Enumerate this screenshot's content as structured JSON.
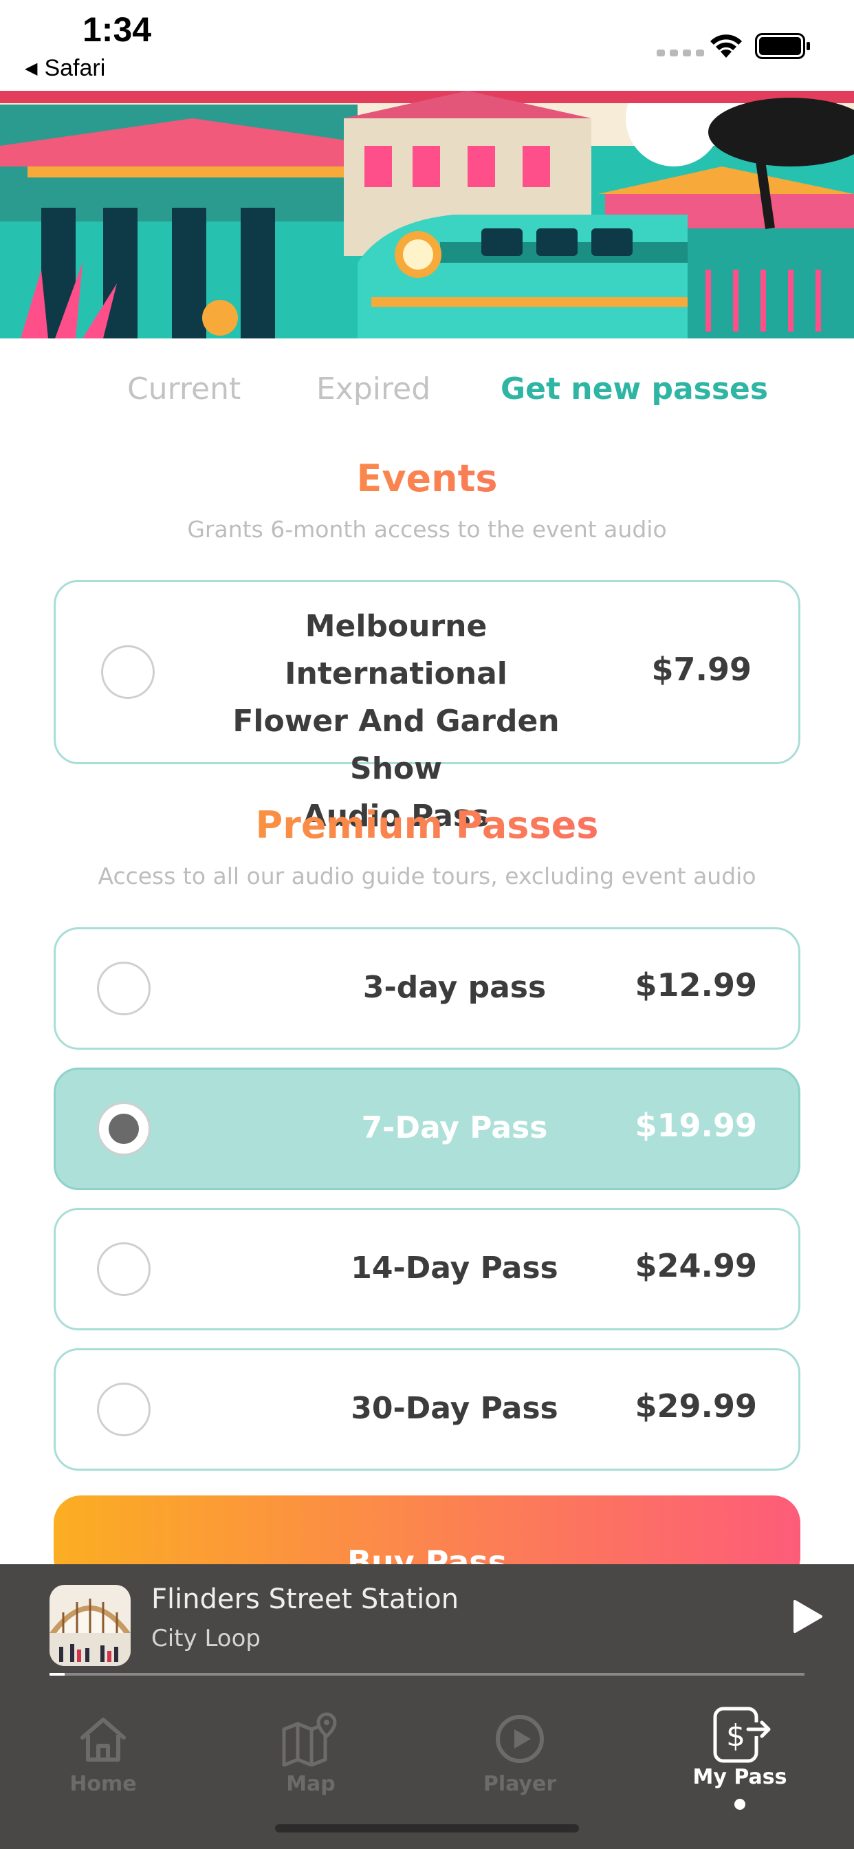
{
  "status_bar": {
    "time": "1:34",
    "back_app": "Safari"
  },
  "tabs": {
    "current": "Current",
    "expired": "Expired",
    "get_new": "Get new passes"
  },
  "events": {
    "title": "Events",
    "subtitle": "Grants 6-month access to the event audio",
    "items": [
      {
        "name_lines": [
          "Melbourne International",
          "Flower And Garden Show",
          "Audio Pass"
        ],
        "price": "$7.99",
        "selected": false
      }
    ]
  },
  "premium": {
    "title": "Premium Passes",
    "subtitle": "Access to all our audio guide tours, excluding event audio",
    "items": [
      {
        "name": "3-day pass",
        "price": "$12.99",
        "selected": false
      },
      {
        "name": "7-Day Pass",
        "price": "$19.99",
        "selected": true
      },
      {
        "name": "14-Day Pass",
        "price": "$24.99",
        "selected": false
      },
      {
        "name": "30-Day Pass",
        "price": "$29.99",
        "selected": false
      }
    ]
  },
  "buy_button": {
    "label": "Buy Pass"
  },
  "mini_player": {
    "title": "Flinders Street Station",
    "subtitle": "City Loop",
    "progress": 0.02
  },
  "tab_bar": {
    "items": [
      {
        "label": "Home",
        "icon": "home-icon",
        "active": false
      },
      {
        "label": "Map",
        "icon": "map-icon",
        "active": false
      },
      {
        "label": "Player",
        "icon": "player-icon",
        "active": false
      },
      {
        "label": "My Pass",
        "icon": "pass-icon",
        "active": true
      }
    ]
  },
  "colors": {
    "accent": "#2fb5a4",
    "gradient_start": "#fbae22",
    "gradient_end": "#fd5c79",
    "selected_card": "#ace0d9",
    "player_bg": "#4a4747"
  }
}
